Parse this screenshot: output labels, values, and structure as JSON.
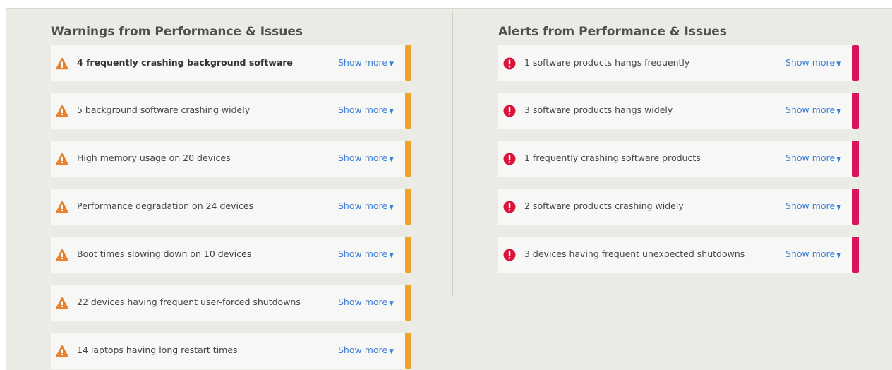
{
  "warnings": {
    "title": "Warnings from Performance & Issues",
    "items": [
      {
        "text": "4 frequently crashing background software",
        "action": "Show more"
      },
      {
        "text": "5 background software crashing widely",
        "action": "Show more"
      },
      {
        "text": "High memory usage on 20 devices",
        "action": "Show more"
      },
      {
        "text": "Performance degradation on 24 devices",
        "action": "Show more"
      },
      {
        "text": "Boot times slowing down on 10 devices",
        "action": "Show more"
      },
      {
        "text": "22 devices having frequent user-forced shutdowns",
        "action": "Show more"
      },
      {
        "text": "14 laptops having long restart times",
        "action": "Show more"
      }
    ]
  },
  "alerts": {
    "title": "Alerts from Performance & Issues",
    "items": [
      {
        "text": "1 software products hangs frequently",
        "action": "Show more"
      },
      {
        "text": "3 software products hangs widely",
        "action": "Show more"
      },
      {
        "text": "1 frequently crashing software products",
        "action": "Show more"
      },
      {
        "text": "2 software products crashing widely",
        "action": "Show more"
      },
      {
        "text": "3 devices having frequent unexpected shutdowns",
        "action": "Show more"
      }
    ]
  },
  "colors": {
    "warning_accent": "#f0a12a",
    "alert_accent": "#d9145a",
    "link": "#3d7fd6"
  },
  "icons": {
    "warning": "warning-triangle-icon",
    "alert": "alert-circle-icon",
    "expand": "caret-down-icon"
  }
}
